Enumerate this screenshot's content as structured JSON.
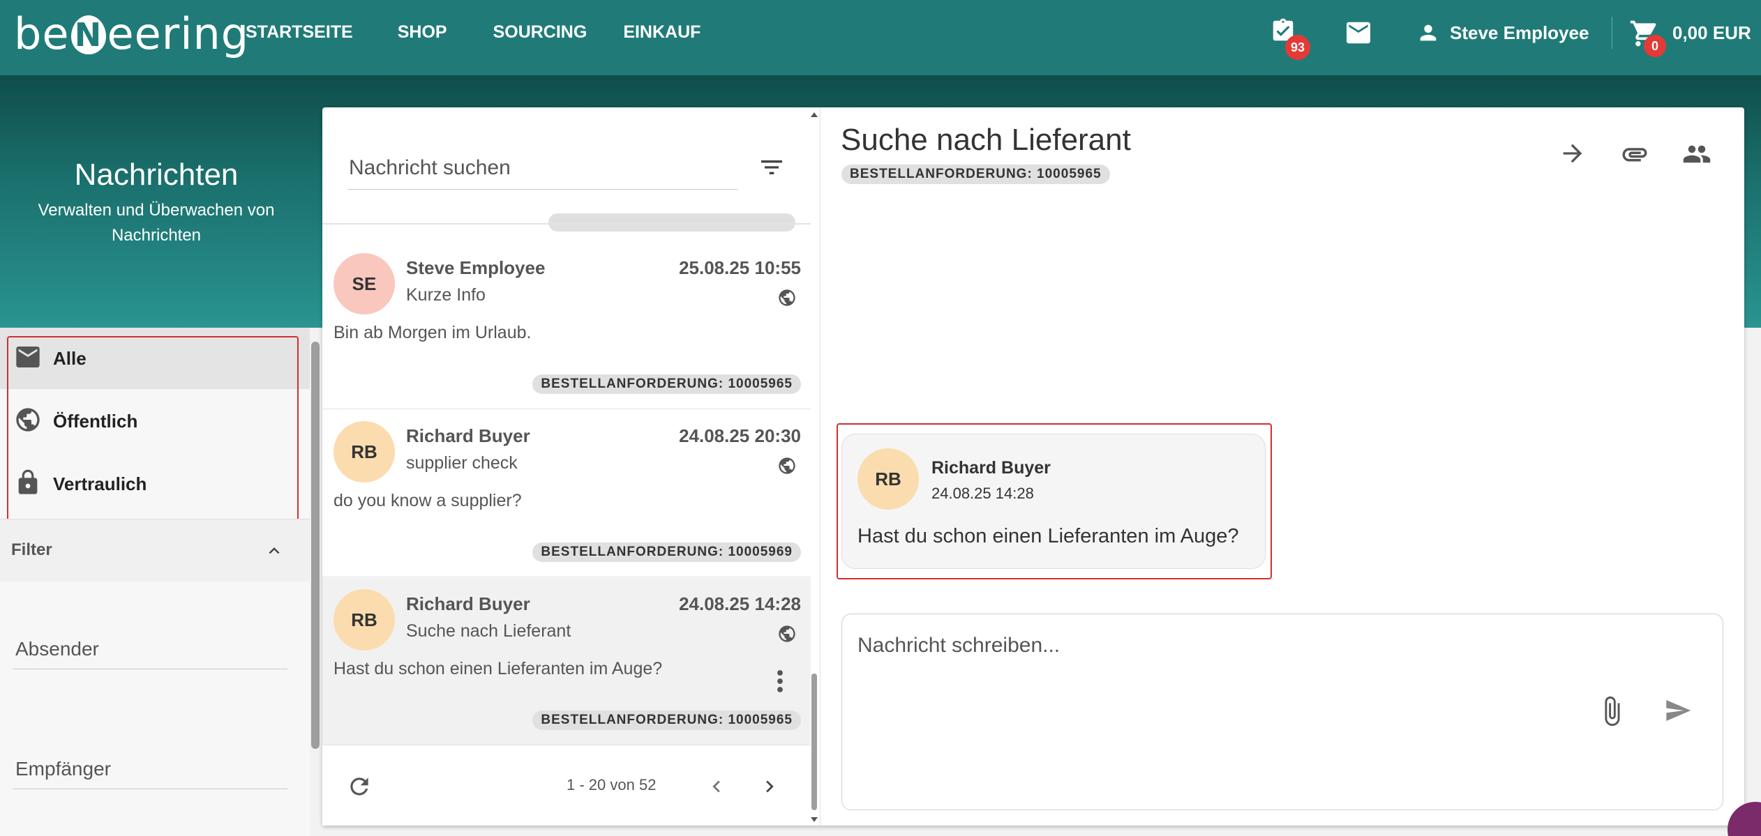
{
  "header": {
    "logo": {
      "pre": "be",
      "mark": "N",
      "post": "eering"
    },
    "nav": [
      "STARTSEITE",
      "SHOP",
      "SOURCING",
      "EINKAUF"
    ],
    "tasks_badge": "93",
    "user_name": "Steve Employee",
    "cart_badge": "0",
    "cart_total": "0,00 EUR"
  },
  "hero": {
    "title": "Nachrichten",
    "subtitle": "Verwalten und Überwachen von Nachrichten"
  },
  "sidebar": {
    "items": [
      {
        "label": "Alle",
        "icon": "mail-icon",
        "active": true
      },
      {
        "label": "Öffentlich",
        "icon": "globe-icon",
        "active": false
      },
      {
        "label": "Vertraulich",
        "icon": "lock-icon",
        "active": false
      }
    ],
    "filter_label": "Filter",
    "sender_label": "Absender",
    "recipient_label": "Empfänger"
  },
  "list": {
    "search_placeholder": "Nachricht suchen",
    "messages": [
      {
        "initials": "SE",
        "name": "Steve Employee",
        "date": "25.08.25 10:55",
        "subject": "Kurze Info",
        "body": "Bin ab Morgen im Urlaub.",
        "tag": "BESTELLANFORDERUNG: 10005965",
        "avatar_color": "#f9c7bd"
      },
      {
        "initials": "RB",
        "name": "Richard Buyer",
        "date": "24.08.25 20:30",
        "subject": "supplier check",
        "body": "do you know a supplier?",
        "tag": "BESTELLANFORDERUNG: 10005969",
        "avatar_color": "#fbdcae"
      },
      {
        "initials": "RB",
        "name": "Richard Buyer",
        "date": "24.08.25 14:28",
        "subject": "Suche nach Lieferant",
        "body": "Hast du schon einen Lieferanten im Auge?",
        "tag": "BESTELLANFORDERUNG: 10005965",
        "avatar_color": "#fbdcae"
      }
    ],
    "pager": "1 - 20 von 52"
  },
  "conversation": {
    "title": "Suche nach Lieferant",
    "tag": "BESTELLANFORDERUNG: 10005965",
    "message": {
      "initials": "RB",
      "name": "Richard Buyer",
      "time": "24.08.25 14:28",
      "text": "Hast du schon einen Lieferanten im Auge?"
    },
    "compose_placeholder": "Nachricht schreiben..."
  },
  "colors": {
    "brand": "#207b78",
    "badge": "#e53935",
    "highlight": "#d32f2f"
  }
}
